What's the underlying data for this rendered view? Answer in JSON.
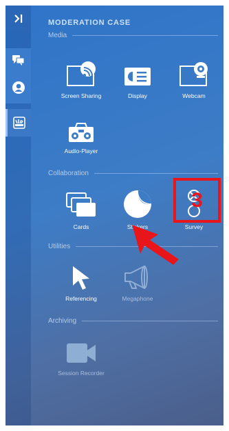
{
  "panel": {
    "title": "MODERATION CASE"
  },
  "sections": {
    "media": "Media",
    "collaboration": "Collaboration",
    "utilities": "Utilities",
    "archiving": "Archiving"
  },
  "tools": {
    "screen_sharing": {
      "label": "Screen Sharing",
      "icon": "screen-share-icon"
    },
    "display": {
      "label": "Display",
      "icon": "display-icon"
    },
    "webcam": {
      "label": "Webcam",
      "icon": "webcam-icon"
    },
    "audio_player": {
      "label": "Audio-Player",
      "icon": "boombox-icon"
    },
    "cards": {
      "label": "Cards",
      "icon": "cards-icon"
    },
    "stickers": {
      "label": "Stickers",
      "icon": "sticker-icon"
    },
    "survey": {
      "label": "Survey",
      "icon": "survey-icon"
    },
    "referencing": {
      "label": "Referencing",
      "icon": "pointer-icon"
    },
    "megaphone": {
      "label": "Megaphone",
      "icon": "megaphone-icon",
      "disabled": true
    },
    "session_recorder": {
      "label": "Session Recorder",
      "icon": "video-camera-icon",
      "disabled": true
    }
  },
  "annotation": {
    "number": "3",
    "color": "#e8161a"
  },
  "colors": {
    "accent": "#2f74c9",
    "annotation": "#e8161a"
  }
}
